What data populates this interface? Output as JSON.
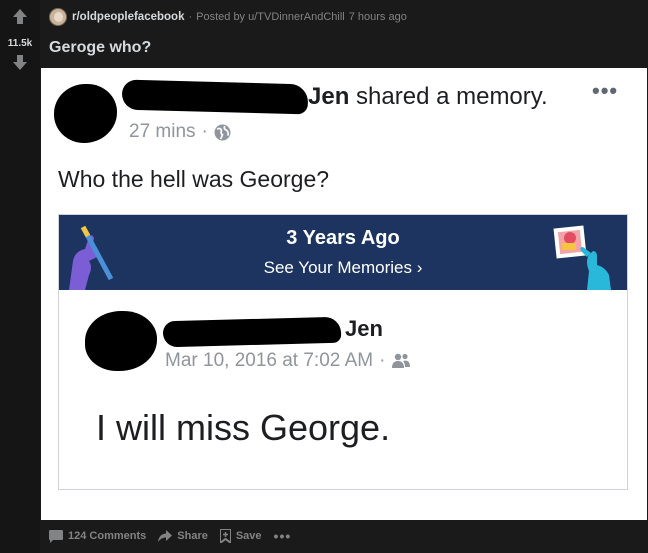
{
  "vote": {
    "score": "11.5k"
  },
  "post": {
    "subreddit": "r/oldpeoplefacebook",
    "posted_by": "Posted by u/TVDinnerAndChill",
    "time_ago": "7 hours ago",
    "separator": "·",
    "title": "Geroge who?"
  },
  "image": {
    "header_name": "Jen",
    "header_action": "shared a memory.",
    "header_time": "27 mins",
    "time_dot": "·",
    "more_dots": "•••",
    "status_text": "Who the hell was George?",
    "memory": {
      "banner_title": "3 Years Ago",
      "banner_sub": "See Your Memories ›",
      "author": "Jen",
      "timestamp": "Mar 10, 2016 at 7:02 AM",
      "time_dot": "·",
      "text": "I will miss George."
    }
  },
  "actions": {
    "comments": "124 Comments",
    "share": "Share",
    "save": "Save",
    "more": "•••"
  },
  "colors": {
    "background": "#1a1a1b",
    "text": "#d7dadc",
    "muted": "#818384",
    "banner": "#1d3461"
  }
}
